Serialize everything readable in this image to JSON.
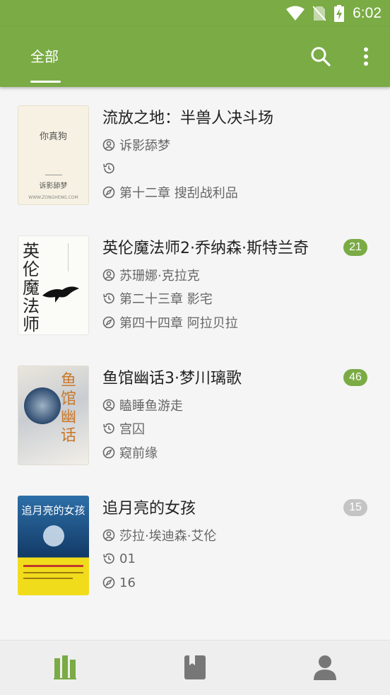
{
  "status_bar": {
    "time": "6:02",
    "icons": [
      "wifi-icon",
      "no-sim-icon",
      "battery-charging-icon"
    ]
  },
  "app_bar": {
    "tab_label": "全部",
    "actions": [
      "search-icon",
      "more-vert-icon"
    ]
  },
  "colors": {
    "primary": "#7aab45",
    "badge_green": "#7aab45",
    "badge_gray": "#c4c4c4"
  },
  "books": [
    {
      "title": "流放之地：半兽人决斗场",
      "author": "诉影舔梦",
      "last_read": "",
      "latest_chapter": "第十二章 搜刮战利品",
      "badge": "",
      "cover": {
        "title_text": "你真狗",
        "author_text": "诉影舔梦",
        "site_text": "WWW.ZONGHENG.COM"
      }
    },
    {
      "title": "英伦魔法师2·乔纳森·斯特兰奇",
      "author": "苏珊娜·克拉克",
      "last_read": "第二十三章 影宅",
      "latest_chapter": "第四十四章 阿拉贝拉",
      "badge": "21",
      "cover": {
        "title_text": "英伦魔法师"
      }
    },
    {
      "title": "鱼馆幽话3·梦川璃歌",
      "author": "瞌睡鱼游走",
      "last_read": "宫囚",
      "latest_chapter": "窥前缘",
      "badge": "46",
      "cover": {
        "title_text": "鱼馆幽话"
      }
    },
    {
      "title": "追月亮的女孩",
      "author": "莎拉·埃迪森·艾伦",
      "last_read": "01",
      "latest_chapter": "16",
      "badge": "15",
      "cover": {
        "title_text": "追月亮的女孩"
      }
    }
  ],
  "bottom_nav": [
    "bookshelf-icon",
    "book-icon",
    "person-icon"
  ]
}
